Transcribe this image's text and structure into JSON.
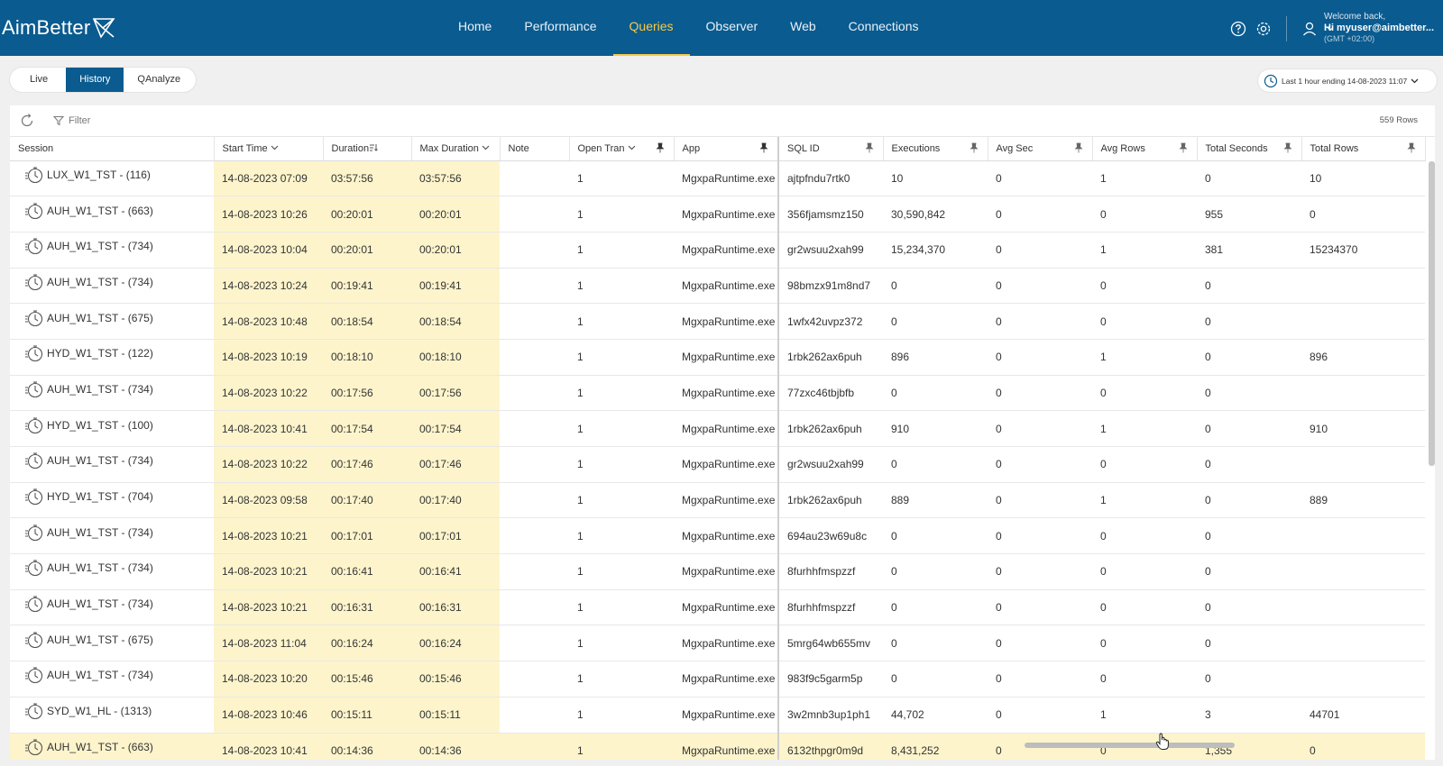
{
  "app": {
    "logo": "AimBetter",
    "nav": [
      "Home",
      "Performance",
      "Queries",
      "Observer",
      "Web",
      "Connections"
    ],
    "active_nav": "Queries",
    "user": {
      "welcome": "Welcome back,",
      "name": "Hi myuser@aimbetter...",
      "tz": "(GMT +02:00)"
    }
  },
  "tabs": [
    "Live",
    "History",
    "QAnalyze"
  ],
  "active_tab": "History",
  "range_label": "Last 1 hour ending  14-08-2023 11:07",
  "toolbar": {
    "filter_label": "Filter",
    "row_count": "559 Rows"
  },
  "columns": {
    "session": "Session",
    "start_time": "Start Time",
    "duration": "Duration",
    "max_duration": "Max Duration",
    "note": "Note",
    "open_tran": "Open Tran",
    "app": "App",
    "sql_id": "SQL ID",
    "executions": "Executions",
    "avg_sec": "Avg Sec",
    "avg_rows": "Avg Rows",
    "total_seconds": "Total Seconds",
    "total_rows": "Total Rows"
  },
  "rows": [
    {
      "session": "LUX_W1_TST - (116)",
      "start": "14-08-2023 07:09",
      "duration": "03:57:56",
      "max": "03:57:56",
      "note": "",
      "open": "1",
      "app": "MgxpaRuntime.exe",
      "sql": "ajtpfndu7rtk0",
      "exec": "10",
      "avgsec": "0",
      "avgrows": "1",
      "totsec": "0",
      "totrows": "10"
    },
    {
      "session": "AUH_W1_TST - (663)",
      "start": "14-08-2023 10:26",
      "duration": "00:20:01",
      "max": "00:20:01",
      "note": "",
      "open": "1",
      "app": "MgxpaRuntime.exe",
      "sql": "356fjamsmz150",
      "exec": "30,590,842",
      "avgsec": "0",
      "avgrows": "0",
      "totsec": "955",
      "totrows": "0"
    },
    {
      "session": "AUH_W1_TST - (734)",
      "start": "14-08-2023 10:04",
      "duration": "00:20:01",
      "max": "00:20:01",
      "note": "",
      "open": "1",
      "app": "MgxpaRuntime.exe",
      "sql": "gr2wsuu2xah99",
      "exec": "15,234,370",
      "avgsec": "0",
      "avgrows": "1",
      "totsec": "381",
      "totrows": "15234370"
    },
    {
      "session": "AUH_W1_TST - (734)",
      "start": "14-08-2023 10:24",
      "duration": "00:19:41",
      "max": "00:19:41",
      "note": "",
      "open": "1",
      "app": "MgxpaRuntime.exe",
      "sql": "98bmzx91m8nd7",
      "exec": "0",
      "avgsec": "0",
      "avgrows": "0",
      "totsec": "0",
      "totrows": ""
    },
    {
      "session": "AUH_W1_TST - (675)",
      "start": "14-08-2023 10:48",
      "duration": "00:18:54",
      "max": "00:18:54",
      "note": "",
      "open": "1",
      "app": "MgxpaRuntime.exe",
      "sql": "1wfx42uvpz372",
      "exec": "0",
      "avgsec": "0",
      "avgrows": "0",
      "totsec": "0",
      "totrows": ""
    },
    {
      "session": "HYD_W1_TST - (122)",
      "start": "14-08-2023 10:19",
      "duration": "00:18:10",
      "max": "00:18:10",
      "note": "",
      "open": "1",
      "app": "MgxpaRuntime.exe",
      "sql": "1rbk262ax6puh",
      "exec": "896",
      "avgsec": "0",
      "avgrows": "1",
      "totsec": "0",
      "totrows": "896"
    },
    {
      "session": "AUH_W1_TST - (734)",
      "start": "14-08-2023 10:22",
      "duration": "00:17:56",
      "max": "00:17:56",
      "note": "",
      "open": "1",
      "app": "MgxpaRuntime.exe",
      "sql": "77zxc46tbjbfb",
      "exec": "0",
      "avgsec": "0",
      "avgrows": "0",
      "totsec": "0",
      "totrows": ""
    },
    {
      "session": "HYD_W1_TST - (100)",
      "start": "14-08-2023 10:41",
      "duration": "00:17:54",
      "max": "00:17:54",
      "note": "",
      "open": "1",
      "app": "MgxpaRuntime.exe",
      "sql": "1rbk262ax6puh",
      "exec": "910",
      "avgsec": "0",
      "avgrows": "1",
      "totsec": "0",
      "totrows": "910"
    },
    {
      "session": "AUH_W1_TST - (734)",
      "start": "14-08-2023 10:22",
      "duration": "00:17:46",
      "max": "00:17:46",
      "note": "",
      "open": "1",
      "app": "MgxpaRuntime.exe",
      "sql": "gr2wsuu2xah99",
      "exec": "0",
      "avgsec": "0",
      "avgrows": "0",
      "totsec": "0",
      "totrows": ""
    },
    {
      "session": "HYD_W1_TST - (704)",
      "start": "14-08-2023 09:58",
      "duration": "00:17:40",
      "max": "00:17:40",
      "note": "",
      "open": "1",
      "app": "MgxpaRuntime.exe",
      "sql": "1rbk262ax6puh",
      "exec": "889",
      "avgsec": "0",
      "avgrows": "1",
      "totsec": "0",
      "totrows": "889"
    },
    {
      "session": "AUH_W1_TST - (734)",
      "start": "14-08-2023 10:21",
      "duration": "00:17:01",
      "max": "00:17:01",
      "note": "",
      "open": "1",
      "app": "MgxpaRuntime.exe",
      "sql": "694au23w69u8c",
      "exec": "0",
      "avgsec": "0",
      "avgrows": "0",
      "totsec": "0",
      "totrows": ""
    },
    {
      "session": "AUH_W1_TST - (734)",
      "start": "14-08-2023 10:21",
      "duration": "00:16:41",
      "max": "00:16:41",
      "note": "",
      "open": "1",
      "app": "MgxpaRuntime.exe",
      "sql": "8furhhfmspzzf",
      "exec": "0",
      "avgsec": "0",
      "avgrows": "0",
      "totsec": "0",
      "totrows": ""
    },
    {
      "session": "AUH_W1_TST - (734)",
      "start": "14-08-2023 10:21",
      "duration": "00:16:31",
      "max": "00:16:31",
      "note": "",
      "open": "1",
      "app": "MgxpaRuntime.exe",
      "sql": "8furhhfmspzzf",
      "exec": "0",
      "avgsec": "0",
      "avgrows": "0",
      "totsec": "0",
      "totrows": ""
    },
    {
      "session": "AUH_W1_TST - (675)",
      "start": "14-08-2023 11:04",
      "duration": "00:16:24",
      "max": "00:16:24",
      "note": "",
      "open": "1",
      "app": "MgxpaRuntime.exe",
      "sql": "5mrg64wb655mv",
      "exec": "0",
      "avgsec": "0",
      "avgrows": "0",
      "totsec": "0",
      "totrows": ""
    },
    {
      "session": "AUH_W1_TST - (734)",
      "start": "14-08-2023 10:20",
      "duration": "00:15:46",
      "max": "00:15:46",
      "note": "",
      "open": "1",
      "app": "MgxpaRuntime.exe",
      "sql": "983f9c5garm5p",
      "exec": "0",
      "avgsec": "0",
      "avgrows": "0",
      "totsec": "0",
      "totrows": ""
    },
    {
      "session": "SYD_W1_HL - (1313)",
      "start": "14-08-2023 10:46",
      "duration": "00:15:11",
      "max": "00:15:11",
      "note": "",
      "open": "1",
      "app": "MgxpaRuntime.exe",
      "sql": "3w2mnb3up1ph1",
      "exec": "44,702",
      "avgsec": "0",
      "avgrows": "1",
      "totsec": "3",
      "totrows": "44701"
    },
    {
      "session": "AUH_W1_TST - (663)",
      "start": "14-08-2023 10:41",
      "duration": "00:14:36",
      "max": "00:14:36",
      "note": "",
      "open": "1",
      "app": "MgxpaRuntime.exe",
      "sql": "6132thpgr0m9d",
      "exec": "8,431,252",
      "avgsec": "0",
      "avgrows": "0",
      "totsec": "1,355",
      "totrows": "0"
    }
  ],
  "colors": {
    "header": "#0a5b8f",
    "active_nav": "#f7c948",
    "highlight": "#fdf4cc"
  }
}
